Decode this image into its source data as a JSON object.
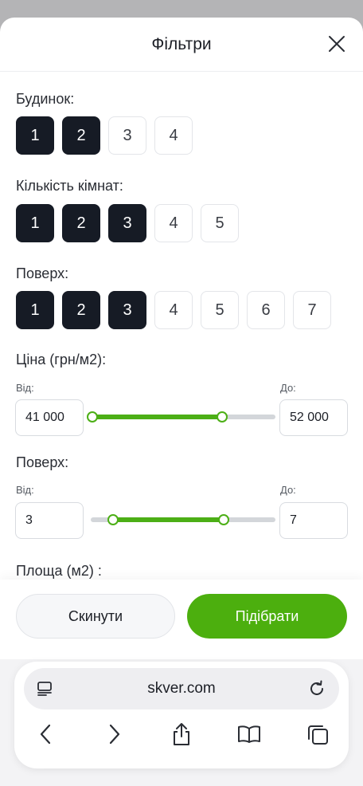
{
  "header": {
    "title": "Фільтри"
  },
  "building": {
    "label": "Будинок:",
    "options": [
      {
        "label": "1",
        "active": true
      },
      {
        "label": "2",
        "active": true
      },
      {
        "label": "3",
        "active": false
      },
      {
        "label": "4",
        "active": false
      }
    ]
  },
  "rooms": {
    "label": "Кількість кімнат:",
    "options": [
      {
        "label": "1",
        "active": true
      },
      {
        "label": "2",
        "active": true
      },
      {
        "label": "3",
        "active": true
      },
      {
        "label": "4",
        "active": false
      },
      {
        "label": "5",
        "active": false
      }
    ]
  },
  "floor": {
    "label": "Поверх:",
    "options": [
      {
        "label": "1",
        "active": true
      },
      {
        "label": "2",
        "active": true
      },
      {
        "label": "3",
        "active": true
      },
      {
        "label": "4",
        "active": false
      },
      {
        "label": "5",
        "active": false
      },
      {
        "label": "6",
        "active": false
      },
      {
        "label": "7",
        "active": false
      }
    ]
  },
  "price": {
    "label": "Ціна (грн/м2):",
    "from_label": "Від:",
    "to_label": "До:",
    "from_value": "41 000",
    "to_value": "52 000",
    "range_fraction": [
      0.0,
      0.71
    ]
  },
  "floor_range": {
    "label": "Поверх:",
    "from_label": "Від:",
    "to_label": "До:",
    "from_value": "3",
    "to_value": "7",
    "range_fraction": [
      0.12,
      0.72
    ]
  },
  "area": {
    "label": "Площа (м2) :"
  },
  "actions": {
    "reset_label": "Скинути",
    "apply_label": "Підібрати"
  },
  "browser": {
    "url": "skver.com"
  },
  "colors": {
    "accent": "#4caf0e",
    "chip_active": "#161b25"
  },
  "icons": [
    "close-icon",
    "tab-icon",
    "reload-icon",
    "back-icon",
    "forward-icon",
    "share-icon",
    "bookmarks-icon",
    "tabs-icon"
  ]
}
